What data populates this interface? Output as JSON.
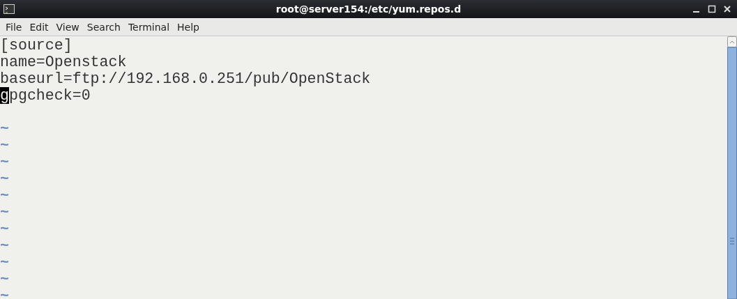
{
  "window": {
    "title": "root@server154:/etc/yum.repos.d"
  },
  "menu": [
    "File",
    "Edit",
    "View",
    "Search",
    "Terminal",
    "Help"
  ],
  "lines": [
    {
      "kind": "text",
      "text": "[source]"
    },
    {
      "kind": "text",
      "text": "name=Openstack"
    },
    {
      "kind": "text",
      "text": "baseurl=ftp://192.168.0.251/pub/OpenStack"
    },
    {
      "kind": "text",
      "cursor_text": "g",
      "text": "pgcheck=0"
    },
    {
      "kind": "blank"
    },
    {
      "kind": "tilde",
      "text": "~"
    },
    {
      "kind": "tilde",
      "text": "~"
    },
    {
      "kind": "tilde",
      "text": "~"
    },
    {
      "kind": "tilde",
      "text": "~"
    },
    {
      "kind": "tilde",
      "text": "~"
    },
    {
      "kind": "tilde",
      "text": "~"
    },
    {
      "kind": "tilde",
      "text": "~"
    },
    {
      "kind": "tilde",
      "text": "~"
    },
    {
      "kind": "tilde",
      "text": "~"
    },
    {
      "kind": "tilde",
      "text": "~"
    },
    {
      "kind": "tilde",
      "text": "~"
    }
  ]
}
